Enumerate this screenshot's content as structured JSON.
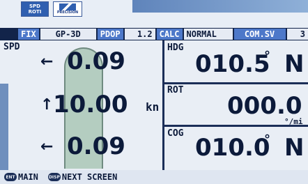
{
  "logos": {
    "speed_top": "SPD",
    "speed_bottom": "ROTI",
    "brand": "PRECISION"
  },
  "status": {
    "fix": "FIX",
    "gps_mode": "GP-3D",
    "pdop_label": "PDOP",
    "pdop_value": "1.2",
    "calc_label": "CALC",
    "calc_mode": "NORMAL",
    "com_sv": "COM.SV",
    "extra": "3"
  },
  "speed": {
    "label": "SPD",
    "fwd_value": "0.09",
    "mid_value": "10.00",
    "aft_value": "0.09",
    "unit": "kn",
    "arrow_fwd": "←",
    "arrow_mid": "↑",
    "arrow_aft": "←"
  },
  "heading": {
    "label": "HDG",
    "value": "010.5",
    "deg": "°",
    "ref": "N"
  },
  "rot": {
    "label": "ROT",
    "value": "000.0",
    "unit": "°/mi"
  },
  "cog": {
    "label": "COG",
    "value": "010.0",
    "deg": "°",
    "ref": "N"
  },
  "footer": {
    "ent_key": "ENT",
    "main_label": "MAIN",
    "disp_key": "DISP",
    "next_label": "NEXT SCREEN"
  },
  "colors": {
    "highlight": "#4d78c9",
    "frame": "#1b2e58",
    "background": "#e9eef5"
  }
}
